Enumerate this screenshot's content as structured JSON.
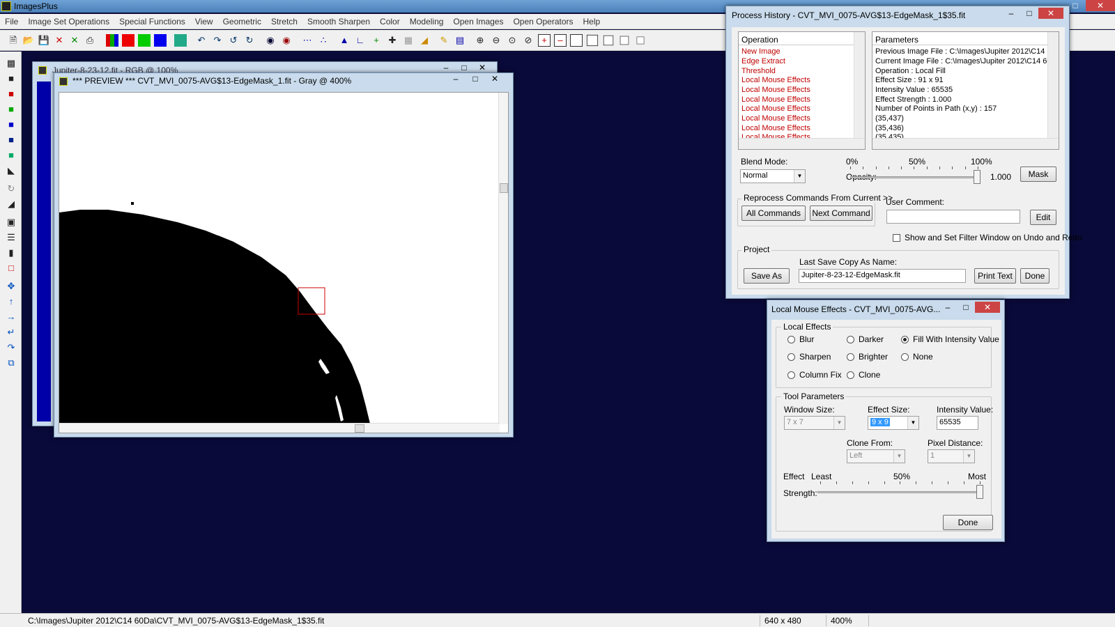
{
  "app": {
    "title": "ImagesPlus"
  },
  "menu": [
    "File",
    "Image Set Operations",
    "Special Functions",
    "View",
    "Geometric",
    "Stretch",
    "Smooth Sharpen",
    "Color",
    "Modeling",
    "Open Images",
    "Open Operators",
    "Help"
  ],
  "background_window": {
    "title": "Jupiter-8-23-12.fit - RGB @ 100%"
  },
  "preview_window": {
    "title": "*** PREVIEW *** CVT_MVI_0075-AVG$13-EdgeMask_1.fit - Gray @ 400%"
  },
  "process_history": {
    "title": "Process History - CVT_MVI_0075-AVG$13-EdgeMask_1$35.fit",
    "operation_header": "Operation",
    "operations": [
      "New Image",
      "Edge Extract",
      "Threshold",
      "Local Mouse Effects",
      "Local Mouse Effects",
      "Local Mouse Effects",
      "Local Mouse Effects",
      "Local Mouse Effects",
      "Local Mouse Effects",
      "Local Mouse Effects"
    ],
    "parameters_header": "Parameters",
    "parameters": [
      "Previous Image File : C:\\Images\\Jupiter 2012\\C14 6",
      "Current Image File : C:\\Images\\Jupiter 2012\\C14 60",
      "Operation : Local Fill",
      "Effect Size : 91 x 91",
      "Intensity Value : 65535",
      "Effect Strength : 1.000",
      "Number of Points in Path (x,y) : 157",
      "(35,437)",
      "(35,436)",
      "(35,435)"
    ],
    "blend_mode_label": "Blend Mode:",
    "blend_mode_value": "Normal",
    "opacity_label": "Opacity:",
    "opacity_ticks": {
      "min": "0%",
      "mid": "50%",
      "max": "100%"
    },
    "opacity_value": "1.000",
    "opacity_level": 1.0,
    "mask_button": "Mask",
    "reprocess_label": "Reprocess Commands From Current >>",
    "all_commands_button": "All Commands",
    "next_command_button": "Next Command",
    "user_comment_label": "User Comment:",
    "user_comment_value": "",
    "edit_button": "Edit",
    "show_filter_label": "Show and Set Filter Window on Undo and Redo",
    "show_filter_checked": false,
    "project_label": "Project",
    "last_save_label": "Last Save Copy As Name:",
    "last_save_value": "Jupiter-8-23-12-EdgeMask.fit",
    "save_as_button": "Save As",
    "print_text_button": "Print Text",
    "done_button": "Done"
  },
  "local_mouse_effects": {
    "title": "Local Mouse Effects - CVT_MVI_0075-AVG...",
    "local_effects_label": "Local Effects",
    "effects": [
      {
        "label": "Blur",
        "selected": false
      },
      {
        "label": "Darker",
        "selected": false
      },
      {
        "label": "Fill With Intensity Value",
        "selected": true
      },
      {
        "label": "Sharpen",
        "selected": false
      },
      {
        "label": "Brighter",
        "selected": false
      },
      {
        "label": "None",
        "selected": false
      },
      {
        "label": "Column Fix",
        "selected": false
      },
      {
        "label": "Clone",
        "selected": false
      }
    ],
    "tool_params_label": "Tool Parameters",
    "window_size_label": "Window Size:",
    "window_size_value": "7 x 7",
    "effect_size_label": "Effect Size:",
    "effect_size_value": "9 x 9",
    "intensity_label": "Intensity Value:",
    "intensity_value": "65535",
    "clone_from_label": "Clone From:",
    "clone_from_value": "Left",
    "pixel_distance_label": "Pixel Distance:",
    "pixel_distance_value": "1",
    "effect_label": "Effect",
    "strength_label": "Strength:",
    "least_label": "Least",
    "mid_label": "50%",
    "most_label": "Most",
    "strength_level": 1.0,
    "done_button": "Done"
  },
  "statusbar": {
    "path": "C:\\Images\\Jupiter 2012\\C14 60Da\\CVT_MVI_0075-AVG$13-EdgeMask_1$35.fit",
    "dimensions": "640 x 480",
    "zoom": "400%"
  },
  "colors": {
    "desktop": "#0a0a3a",
    "accent": "#3399ff",
    "operation_text": "#c00000"
  }
}
